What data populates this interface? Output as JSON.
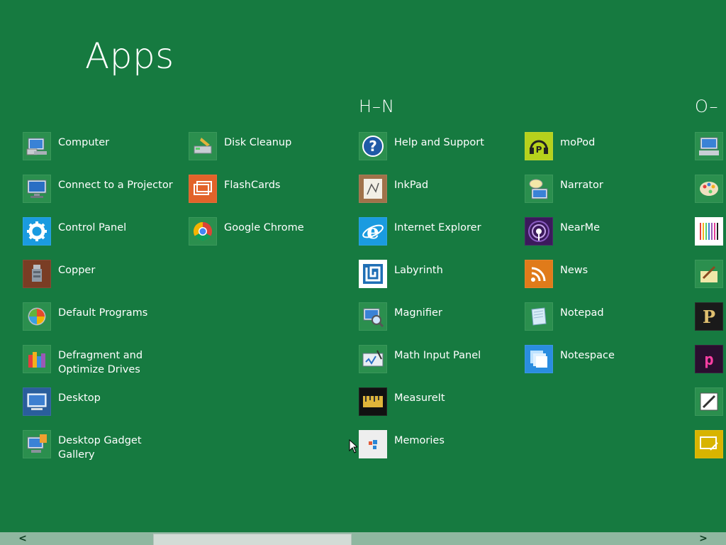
{
  "title": "Apps",
  "groups": [
    {
      "label": "H–N"
    },
    {
      "label": "O–"
    }
  ],
  "columns": {
    "col1": [
      {
        "label": "Computer",
        "icon": "computer-icon"
      },
      {
        "label": "Connect to a Projector",
        "icon": "projector-icon"
      },
      {
        "label": "Control Panel",
        "icon": "gear-icon"
      },
      {
        "label": "Copper",
        "icon": "copper-icon"
      },
      {
        "label": "Default Programs",
        "icon": "default-programs-icon"
      },
      {
        "label": "Defragment and Optimize Drives",
        "icon": "defrag-icon"
      },
      {
        "label": "Desktop",
        "icon": "desktop-icon"
      },
      {
        "label": "Desktop Gadget Gallery",
        "icon": "gadget-gallery-icon"
      }
    ],
    "col2": [
      {
        "label": "Disk Cleanup",
        "icon": "disk-cleanup-icon"
      },
      {
        "label": "FlashCards",
        "icon": "flashcards-icon"
      },
      {
        "label": "Google Chrome",
        "icon": "chrome-icon"
      }
    ],
    "col3": [
      {
        "label": "Help and Support",
        "icon": "help-icon"
      },
      {
        "label": "InkPad",
        "icon": "inkpad-icon"
      },
      {
        "label": "Internet Explorer",
        "icon": "ie-icon"
      },
      {
        "label": "Labyrinth",
        "icon": "labyrinth-icon"
      },
      {
        "label": "Magnifier",
        "icon": "magnifier-icon"
      },
      {
        "label": "Math Input Panel",
        "icon": "math-input-icon"
      },
      {
        "label": "MeasureIt",
        "icon": "measureit-icon"
      },
      {
        "label": "Memories",
        "icon": "memories-icon"
      }
    ],
    "col4": [
      {
        "label": "moPod",
        "icon": "mopod-icon"
      },
      {
        "label": "Narrator",
        "icon": "narrator-icon"
      },
      {
        "label": "NearMe",
        "icon": "nearme-icon"
      },
      {
        "label": "News",
        "icon": "rss-icon"
      },
      {
        "label": "Notepad",
        "icon": "notepad-icon"
      },
      {
        "label": "Notespace",
        "icon": "notespace-icon"
      }
    ]
  },
  "scrollbar": {
    "left_arrow": "<",
    "right_arrow": ">"
  },
  "colors": {
    "background": "#167a40",
    "tile": "#2b8f4e",
    "scrollbar": "#8fb7a0"
  }
}
